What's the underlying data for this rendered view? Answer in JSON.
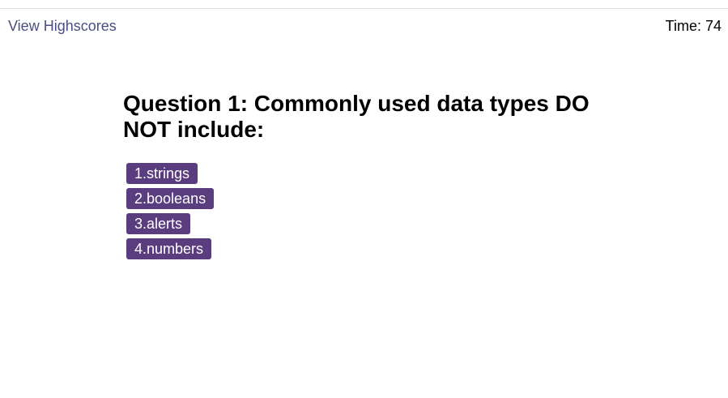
{
  "header": {
    "highscores_label": "View Highscores",
    "time_label": "Time:",
    "time_value": "74"
  },
  "quiz": {
    "question": "Question 1: Commonly used data types DO NOT include:",
    "choices": [
      {
        "label": "1.strings"
      },
      {
        "label": "2.booleans"
      },
      {
        "label": "3.alerts"
      },
      {
        "label": "4.numbers"
      }
    ]
  },
  "colors": {
    "accent": "#5a3d7e",
    "link": "#4b4e80"
  }
}
